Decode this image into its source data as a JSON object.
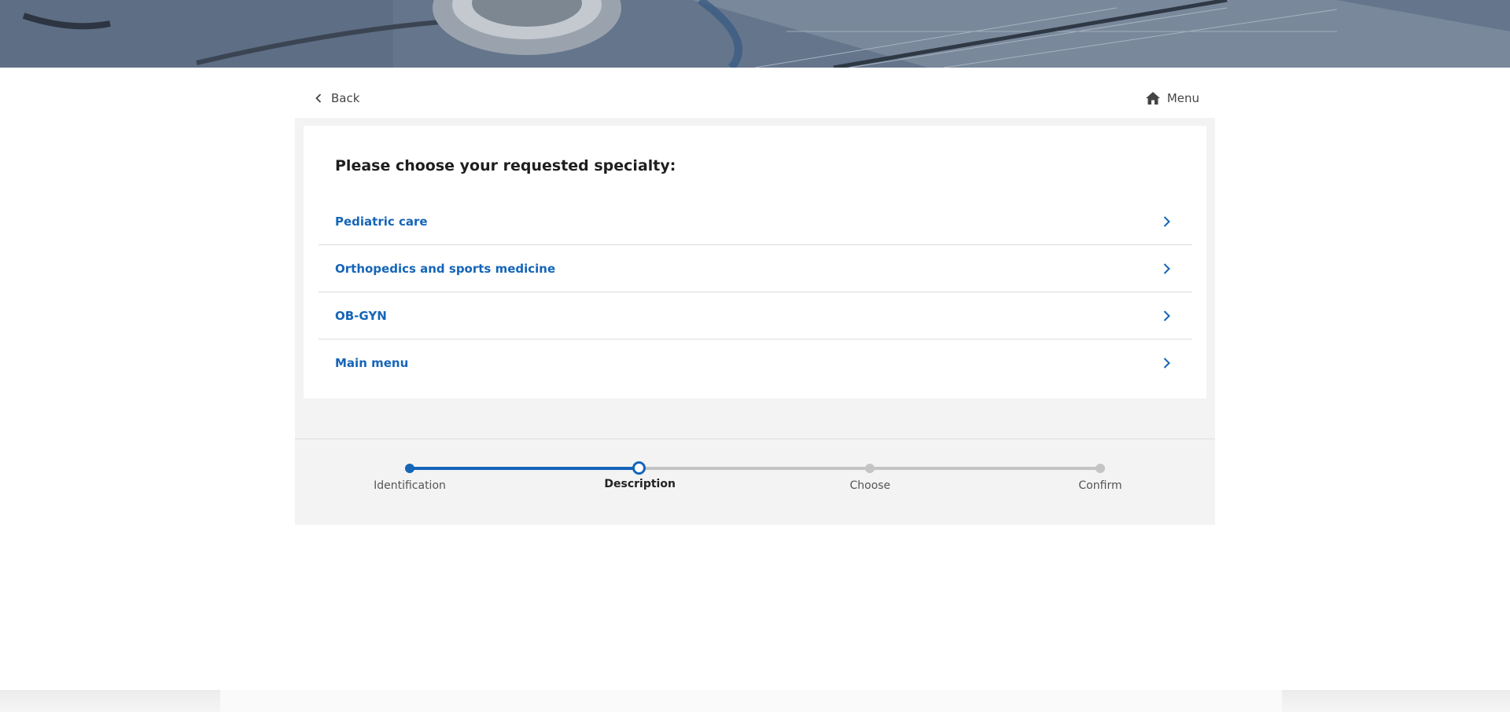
{
  "nav": {
    "back_label": "Back",
    "menu_label": "Menu"
  },
  "form": {
    "question": "Please choose your requested specialty:",
    "options": [
      {
        "label": "Pediatric care"
      },
      {
        "label": "Orthopedics and sports medicine"
      },
      {
        "label": "OB-GYN"
      },
      {
        "label": "Main menu"
      }
    ]
  },
  "stepper": {
    "steps": [
      {
        "label": "Identification",
        "state": "done"
      },
      {
        "label": "Description",
        "state": "current"
      },
      {
        "label": "Choose",
        "state": "upcoming"
      },
      {
        "label": "Confirm",
        "state": "upcoming"
      }
    ],
    "current_step": 2,
    "total_steps": 4
  },
  "colors": {
    "accent": "#1565b8",
    "inactive": "#c4c4c4",
    "panel": "#f3f3f3"
  },
  "icons": {
    "back": "chevron-left-icon",
    "menu": "home-icon",
    "option": "chevron-right-icon"
  }
}
